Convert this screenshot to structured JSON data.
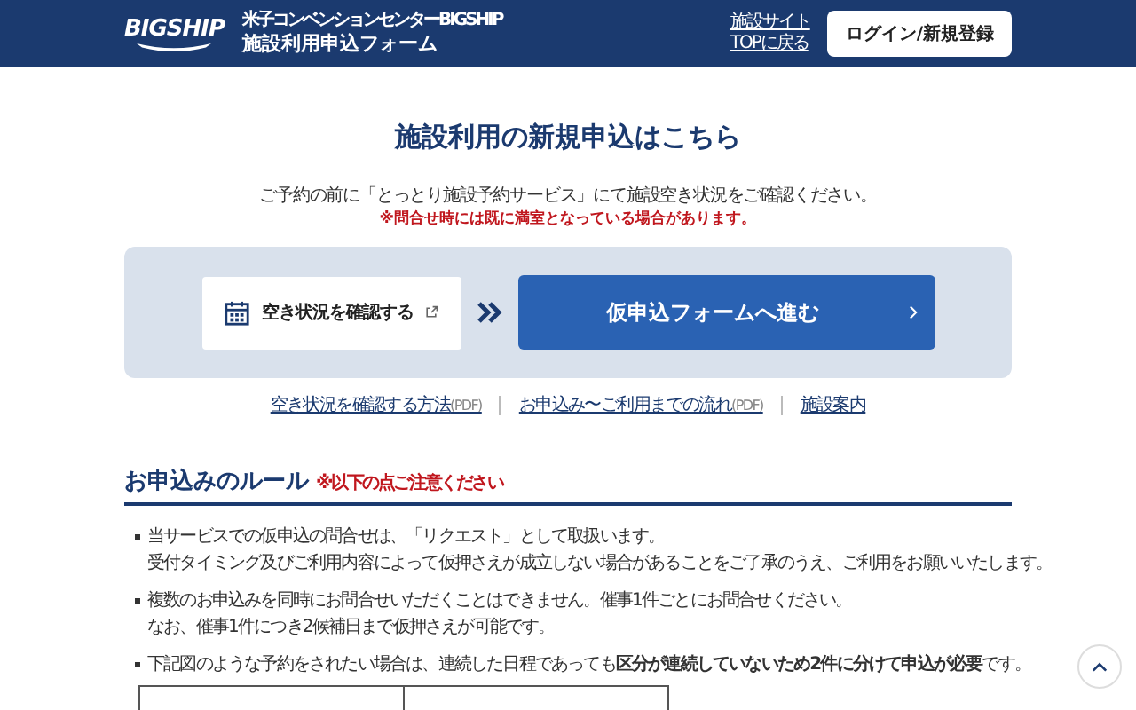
{
  "header": {
    "logo": "BIGSHIP",
    "subtitle": "米子コンベンションセンターBIGSHIP",
    "title": "施設利用申込フォーム",
    "site_link": [
      "施設サイト",
      "TOPに戻る"
    ],
    "login_button": "ログイン/新規登録"
  },
  "main": {
    "title": "施設利用の新規申込はこちら",
    "intro": "ご予約の前に「とっとり施設予約サービス」にて施設空き状況をご確認ください。",
    "notice": "※問合せ時には既に満室となっている場合があります。",
    "check_button": "空き状況を確認する",
    "proceed_button": "仮申込フォームへ進む",
    "links": [
      {
        "text": "空き状況を確認する方法",
        "tag": "(PDF)"
      },
      {
        "text": "お申込み〜ご利用までの流れ",
        "tag": "(PDF)"
      },
      {
        "text": "施設案内"
      }
    ]
  },
  "rules": {
    "heading": "お申込みのルール",
    "note": "※以下の点ご注意ください",
    "items": [
      {
        "lines": [
          "当サービスでの仮申込の問合せは、「リクエスト」として取扱います。",
          "受付タイミング及びご利用内容によって仮押さえが成立しない場合があることをご了承のうえ、ご利用をお願いいたします。"
        ]
      },
      {
        "lines": [
          "複数のお申込みを同時にお問合せいただくことはできません。催事1件ごとにお問合せください。",
          "なお、催事1件につき2候補日まで仮押さえが可能です。"
        ]
      },
      {
        "lines": [
          "下記図のような予約をされたい場合は、連続した日程であっても**区分が連続していないため2件に分けて申込が必要**です。"
        ]
      }
    ]
  }
}
